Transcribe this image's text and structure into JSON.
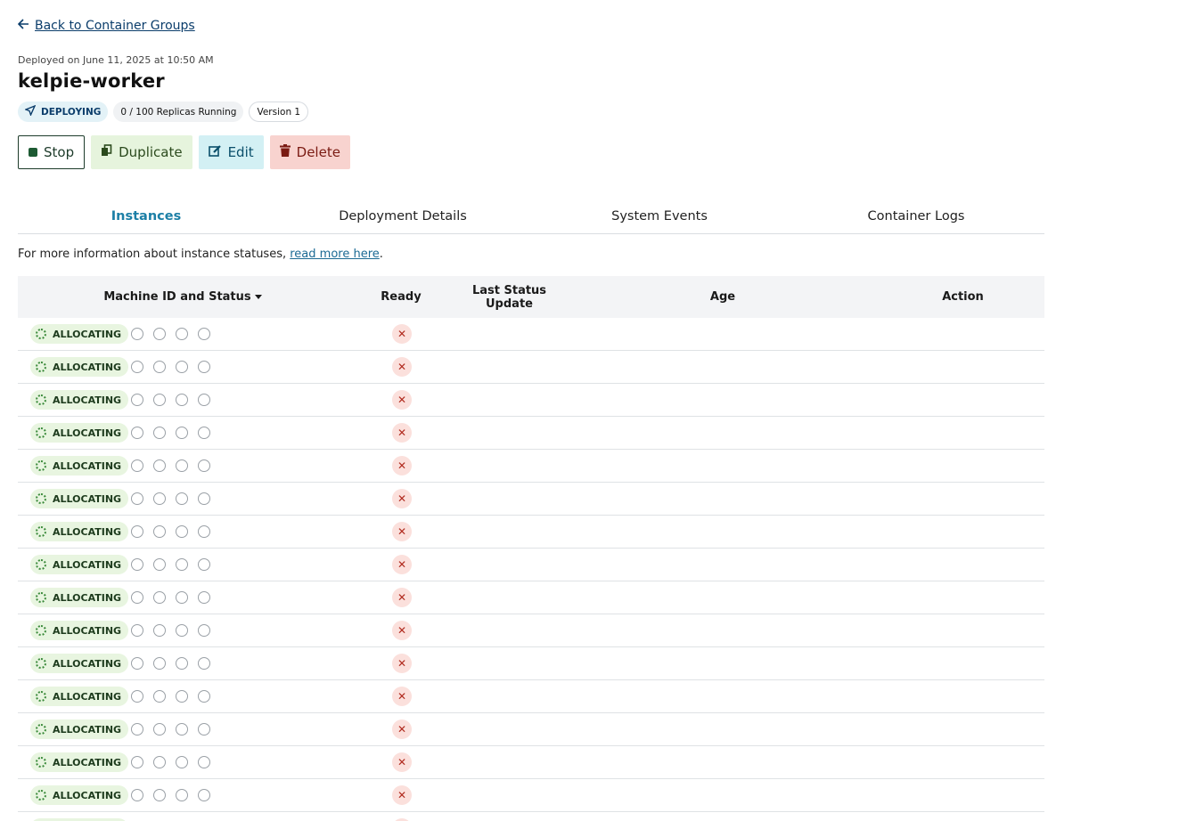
{
  "nav": {
    "back_label": "Back to Container Groups"
  },
  "header": {
    "deployed_text": "Deployed on June 11, 2025 at 10:50 AM",
    "title": "kelpie-worker",
    "badges": {
      "status": "DEPLOYING",
      "replicas": "0 / 100 Replicas Running",
      "version": "Version 1"
    }
  },
  "actions": {
    "stop": "Stop",
    "duplicate": "Duplicate",
    "edit": "Edit",
    "delete": "Delete"
  },
  "tabs": [
    {
      "label": "Instances",
      "active": true
    },
    {
      "label": "Deployment Details",
      "active": false
    },
    {
      "label": "System Events",
      "active": false
    },
    {
      "label": "Container Logs",
      "active": false
    }
  ],
  "info": {
    "text": "For more information about instance statuses, ",
    "link": "read more here",
    "suffix": "."
  },
  "table": {
    "columns": [
      "Machine ID and Status",
      "Ready",
      "Last Status Update",
      "Age",
      "Action"
    ],
    "rows": [
      {
        "status": "ALLOCATING",
        "ready": "✕"
      },
      {
        "status": "ALLOCATING",
        "ready": "✕"
      },
      {
        "status": "ALLOCATING",
        "ready": "✕"
      },
      {
        "status": "ALLOCATING",
        "ready": "✕"
      },
      {
        "status": "ALLOCATING",
        "ready": "✕"
      },
      {
        "status": "ALLOCATING",
        "ready": "✕"
      },
      {
        "status": "ALLOCATING",
        "ready": "✕"
      },
      {
        "status": "ALLOCATING",
        "ready": "✕"
      },
      {
        "status": "ALLOCATING",
        "ready": "✕"
      },
      {
        "status": "ALLOCATING",
        "ready": "✕"
      },
      {
        "status": "ALLOCATING",
        "ready": "✕"
      },
      {
        "status": "ALLOCATING",
        "ready": "✕"
      },
      {
        "status": "ALLOCATING",
        "ready": "✕"
      },
      {
        "status": "ALLOCATING",
        "ready": "✕"
      },
      {
        "status": "ALLOCATING",
        "ready": "✕"
      },
      {
        "status": "ALLOCATING",
        "ready": "✕"
      }
    ]
  },
  "colors": {
    "accent": "#1c7fa6",
    "deploying_bg": "#e3f2f7",
    "allocating_bg": "#e8f5e0",
    "not_ready": "#b02a1e"
  }
}
